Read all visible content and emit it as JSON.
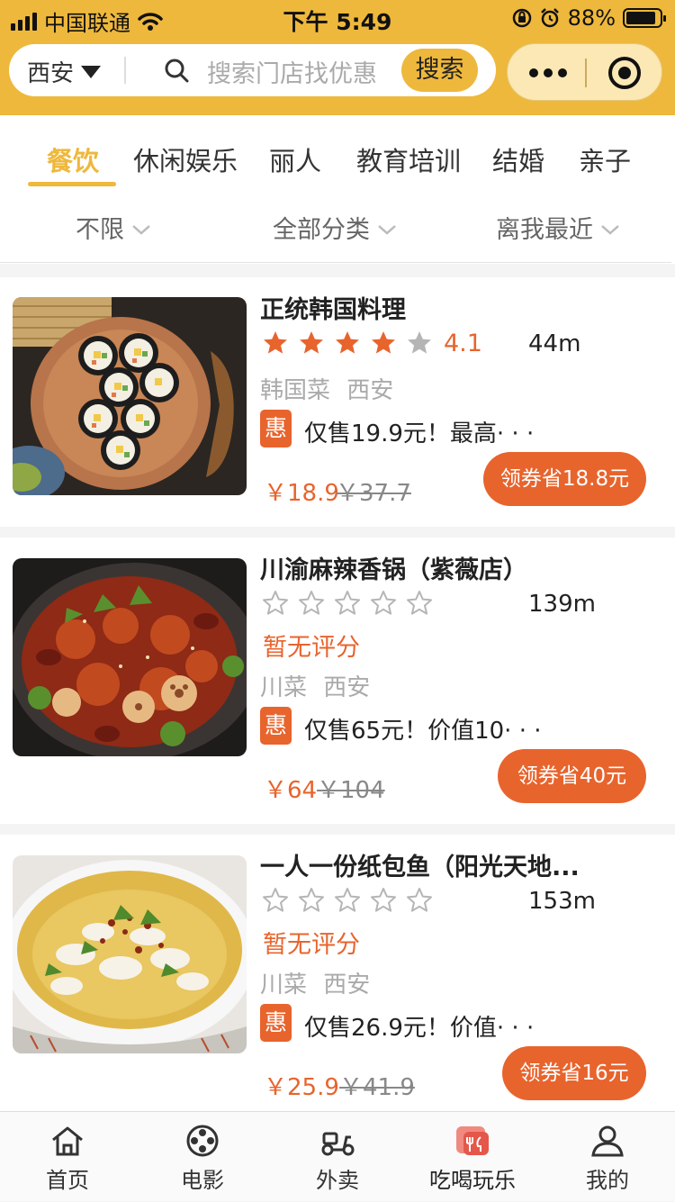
{
  "status_bar": {
    "carrier": "中国联通",
    "time": "下午 5:49",
    "battery": "88%",
    "battery_level": 0.88
  },
  "search": {
    "city": "西安",
    "placeholder": "搜索门店找优惠",
    "button_label": "搜索"
  },
  "category_tabs": [
    {
      "label": "餐饮",
      "active": true
    },
    {
      "label": "休闲娱乐",
      "active": false
    },
    {
      "label": "丽人",
      "active": false
    },
    {
      "label": "教育培训",
      "active": false
    },
    {
      "label": "结婚",
      "active": false
    },
    {
      "label": "亲子",
      "active": false
    }
  ],
  "filters": [
    {
      "label": "不限"
    },
    {
      "label": "全部分类"
    },
    {
      "label": "离我最近"
    }
  ],
  "stores": [
    {
      "name": "正统韩国料理",
      "rating": 4,
      "score": "4.1",
      "distance": "44m",
      "no_rating_text": "",
      "tags": "韩国菜 西安",
      "badge": "惠",
      "offer": "仅售19.9元！最高· · ·",
      "price": "￥18.9",
      "original_price": "￥37.7",
      "coupon_label": "领券省18.8元",
      "thumb_icon": "kimbap-photo"
    },
    {
      "name": "川渝麻辣香锅（紫薇店）",
      "rating": 0,
      "score": "",
      "distance": "139m",
      "no_rating_text": "暂无评分",
      "tags": "川菜 西安",
      "badge": "惠",
      "offer": "仅售65元！价值10· · ·",
      "price": "￥64",
      "original_price": "￥104",
      "coupon_label": "领券省40元",
      "thumb_icon": "spicy-hotpot-photo"
    },
    {
      "name": "一人一份纸包鱼（阳光天地...",
      "rating": 0,
      "score": "",
      "distance": "153m",
      "no_rating_text": "暂无评分",
      "tags": "川菜 西安",
      "badge": "惠",
      "offer": "仅售26.9元！价值· · ·",
      "price": "￥25.9",
      "original_price": "￥41.9",
      "coupon_label": "领券省16元",
      "thumb_icon": "fish-soup-photo"
    }
  ],
  "tab_bar": [
    {
      "label": "首页",
      "icon": "home-icon",
      "active": false
    },
    {
      "label": "电影",
      "icon": "film-reel-icon",
      "active": false
    },
    {
      "label": "外卖",
      "icon": "scooter-icon",
      "active": false
    },
    {
      "label": "吃喝玩乐",
      "icon": "food-icon",
      "active": true
    },
    {
      "label": "我的",
      "icon": "user-icon",
      "active": false
    }
  ],
  "colors": {
    "brand_yellow": "#eeb83c",
    "accent_orange": "#e8642d",
    "star_gray": "#b5b5b5"
  }
}
